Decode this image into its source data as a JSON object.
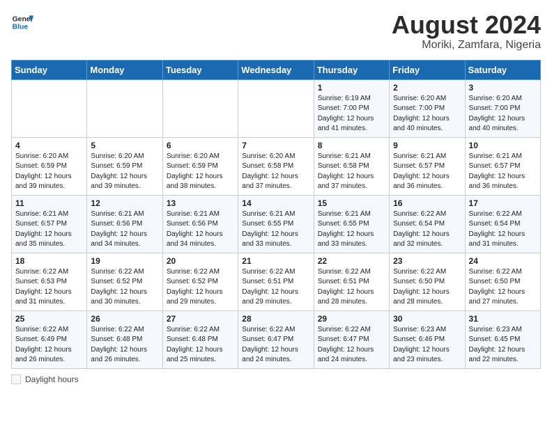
{
  "header": {
    "logo_line1": "General",
    "logo_line2": "Blue",
    "month_title": "August 2024",
    "location": "Moriki, Zamfara, Nigeria"
  },
  "days_of_week": [
    "Sunday",
    "Monday",
    "Tuesday",
    "Wednesday",
    "Thursday",
    "Friday",
    "Saturday"
  ],
  "weeks": [
    [
      {
        "day": "",
        "info": ""
      },
      {
        "day": "",
        "info": ""
      },
      {
        "day": "",
        "info": ""
      },
      {
        "day": "",
        "info": ""
      },
      {
        "day": "1",
        "info": "Sunrise: 6:19 AM\nSunset: 7:00 PM\nDaylight: 12 hours\nand 41 minutes."
      },
      {
        "day": "2",
        "info": "Sunrise: 6:20 AM\nSunset: 7:00 PM\nDaylight: 12 hours\nand 40 minutes."
      },
      {
        "day": "3",
        "info": "Sunrise: 6:20 AM\nSunset: 7:00 PM\nDaylight: 12 hours\nand 40 minutes."
      }
    ],
    [
      {
        "day": "4",
        "info": "Sunrise: 6:20 AM\nSunset: 6:59 PM\nDaylight: 12 hours\nand 39 minutes."
      },
      {
        "day": "5",
        "info": "Sunrise: 6:20 AM\nSunset: 6:59 PM\nDaylight: 12 hours\nand 39 minutes."
      },
      {
        "day": "6",
        "info": "Sunrise: 6:20 AM\nSunset: 6:59 PM\nDaylight: 12 hours\nand 38 minutes."
      },
      {
        "day": "7",
        "info": "Sunrise: 6:20 AM\nSunset: 6:58 PM\nDaylight: 12 hours\nand 37 minutes."
      },
      {
        "day": "8",
        "info": "Sunrise: 6:21 AM\nSunset: 6:58 PM\nDaylight: 12 hours\nand 37 minutes."
      },
      {
        "day": "9",
        "info": "Sunrise: 6:21 AM\nSunset: 6:57 PM\nDaylight: 12 hours\nand 36 minutes."
      },
      {
        "day": "10",
        "info": "Sunrise: 6:21 AM\nSunset: 6:57 PM\nDaylight: 12 hours\nand 36 minutes."
      }
    ],
    [
      {
        "day": "11",
        "info": "Sunrise: 6:21 AM\nSunset: 6:57 PM\nDaylight: 12 hours\nand 35 minutes."
      },
      {
        "day": "12",
        "info": "Sunrise: 6:21 AM\nSunset: 6:56 PM\nDaylight: 12 hours\nand 34 minutes."
      },
      {
        "day": "13",
        "info": "Sunrise: 6:21 AM\nSunset: 6:56 PM\nDaylight: 12 hours\nand 34 minutes."
      },
      {
        "day": "14",
        "info": "Sunrise: 6:21 AM\nSunset: 6:55 PM\nDaylight: 12 hours\nand 33 minutes."
      },
      {
        "day": "15",
        "info": "Sunrise: 6:21 AM\nSunset: 6:55 PM\nDaylight: 12 hours\nand 33 minutes."
      },
      {
        "day": "16",
        "info": "Sunrise: 6:22 AM\nSunset: 6:54 PM\nDaylight: 12 hours\nand 32 minutes."
      },
      {
        "day": "17",
        "info": "Sunrise: 6:22 AM\nSunset: 6:54 PM\nDaylight: 12 hours\nand 31 minutes."
      }
    ],
    [
      {
        "day": "18",
        "info": "Sunrise: 6:22 AM\nSunset: 6:53 PM\nDaylight: 12 hours\nand 31 minutes."
      },
      {
        "day": "19",
        "info": "Sunrise: 6:22 AM\nSunset: 6:52 PM\nDaylight: 12 hours\nand 30 minutes."
      },
      {
        "day": "20",
        "info": "Sunrise: 6:22 AM\nSunset: 6:52 PM\nDaylight: 12 hours\nand 29 minutes."
      },
      {
        "day": "21",
        "info": "Sunrise: 6:22 AM\nSunset: 6:51 PM\nDaylight: 12 hours\nand 29 minutes."
      },
      {
        "day": "22",
        "info": "Sunrise: 6:22 AM\nSunset: 6:51 PM\nDaylight: 12 hours\nand 28 minutes."
      },
      {
        "day": "23",
        "info": "Sunrise: 6:22 AM\nSunset: 6:50 PM\nDaylight: 12 hours\nand 28 minutes."
      },
      {
        "day": "24",
        "info": "Sunrise: 6:22 AM\nSunset: 6:50 PM\nDaylight: 12 hours\nand 27 minutes."
      }
    ],
    [
      {
        "day": "25",
        "info": "Sunrise: 6:22 AM\nSunset: 6:49 PM\nDaylight: 12 hours\nand 26 minutes."
      },
      {
        "day": "26",
        "info": "Sunrise: 6:22 AM\nSunset: 6:48 PM\nDaylight: 12 hours\nand 26 minutes."
      },
      {
        "day": "27",
        "info": "Sunrise: 6:22 AM\nSunset: 6:48 PM\nDaylight: 12 hours\nand 25 minutes."
      },
      {
        "day": "28",
        "info": "Sunrise: 6:22 AM\nSunset: 6:47 PM\nDaylight: 12 hours\nand 24 minutes."
      },
      {
        "day": "29",
        "info": "Sunrise: 6:22 AM\nSunset: 6:47 PM\nDaylight: 12 hours\nand 24 minutes."
      },
      {
        "day": "30",
        "info": "Sunrise: 6:23 AM\nSunset: 6:46 PM\nDaylight: 12 hours\nand 23 minutes."
      },
      {
        "day": "31",
        "info": "Sunrise: 6:23 AM\nSunset: 6:45 PM\nDaylight: 12 hours\nand 22 minutes."
      }
    ]
  ],
  "footer": {
    "daylight_label": "Daylight hours"
  }
}
